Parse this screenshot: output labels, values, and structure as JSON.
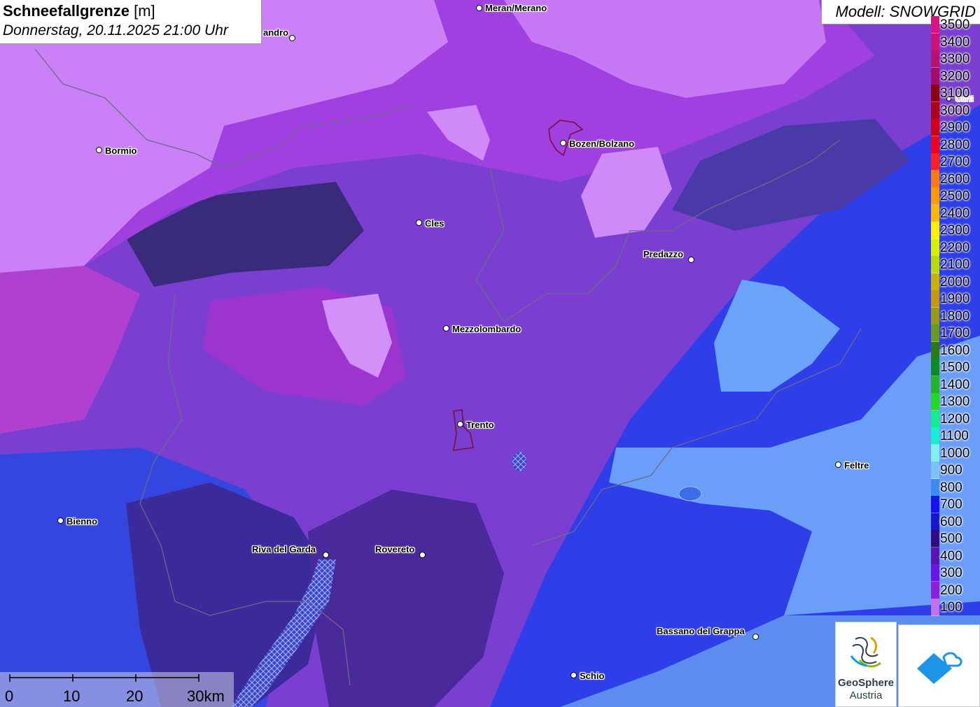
{
  "title": {
    "main": "Schneefallgrenze",
    "unit": "[m]",
    "datetime": "Donnerstag, 20.11.2025 21:00 Uhr"
  },
  "model": "Modell: SNOWGRID",
  "legend": [
    {
      "label": "3500",
      "color": "#d9157f"
    },
    {
      "label": "3400",
      "color": "#cc1478"
    },
    {
      "label": "3300",
      "color": "#b8116f"
    },
    {
      "label": "3200",
      "color": "#a40c6b"
    },
    {
      "label": "3100",
      "color": "#8c0010"
    },
    {
      "label": "3000",
      "color": "#ad0018"
    },
    {
      "label": "2900",
      "color": "#d10018"
    },
    {
      "label": "2800",
      "color": "#f0001a"
    },
    {
      "label": "2700",
      "color": "#ff2020"
    },
    {
      "label": "2600",
      "color": "#ff7a10"
    },
    {
      "label": "2500",
      "color": "#ff9a00"
    },
    {
      "label": "2400",
      "color": "#ffb800"
    },
    {
      "label": "2300",
      "color": "#fff000"
    },
    {
      "label": "2200",
      "color": "#d8f000"
    },
    {
      "label": "2100",
      "color": "#bada00"
    },
    {
      "label": "2000",
      "color": "#c9b200"
    },
    {
      "label": "1900",
      "color": "#c39a0c"
    },
    {
      "label": "1800",
      "color": "#9a9a10"
    },
    {
      "label": "1700",
      "color": "#6a9a1a"
    },
    {
      "label": "1600",
      "color": "#2c7a14"
    },
    {
      "label": "1500",
      "color": "#0d8a24"
    },
    {
      "label": "1400",
      "color": "#22b422"
    },
    {
      "label": "1300",
      "color": "#22d822"
    },
    {
      "label": "1200",
      "color": "#10ee90"
    },
    {
      "label": "1100",
      "color": "#14f0d0"
    },
    {
      "label": "1000",
      "color": "#80f0f0"
    },
    {
      "label": "900",
      "color": "#80c0f8"
    },
    {
      "label": "800",
      "color": "#3c8cf0"
    },
    {
      "label": "700",
      "color": "#1414f0"
    },
    {
      "label": "600",
      "color": "#1818c8"
    },
    {
      "label": "500",
      "color": "#300c80"
    },
    {
      "label": "400",
      "color": "#5a14b4"
    },
    {
      "label": "300",
      "color": "#6a14e6"
    },
    {
      "label": "200",
      "color": "#8c20d8"
    },
    {
      "label": "100",
      "color": "#c070f0"
    }
  ],
  "cities": [
    {
      "name": "Meran/Merano"
    },
    {
      "name": "andro"
    },
    {
      "name": "Bormio"
    },
    {
      "name": "Bozen/Bolzano"
    },
    {
      "name": "Cles"
    },
    {
      "name": "Predazzo"
    },
    {
      "name": "Mezzolombardo"
    },
    {
      "name": "Trento"
    },
    {
      "name": "Feltre"
    },
    {
      "name": "Bienno"
    },
    {
      "name": "Riva del Garda"
    },
    {
      "name": "Rovereto"
    },
    {
      "name": "Bassano del Grappa"
    },
    {
      "name": "Schio"
    },
    {
      "name": "Corti"
    }
  ],
  "scale": [
    "0",
    "10",
    "20",
    "30km"
  ],
  "logo": {
    "line1": "GeoSphere",
    "line2": "Austria",
    "icon": "geosphere-logo"
  },
  "app_icon": "snow-app-icon"
}
